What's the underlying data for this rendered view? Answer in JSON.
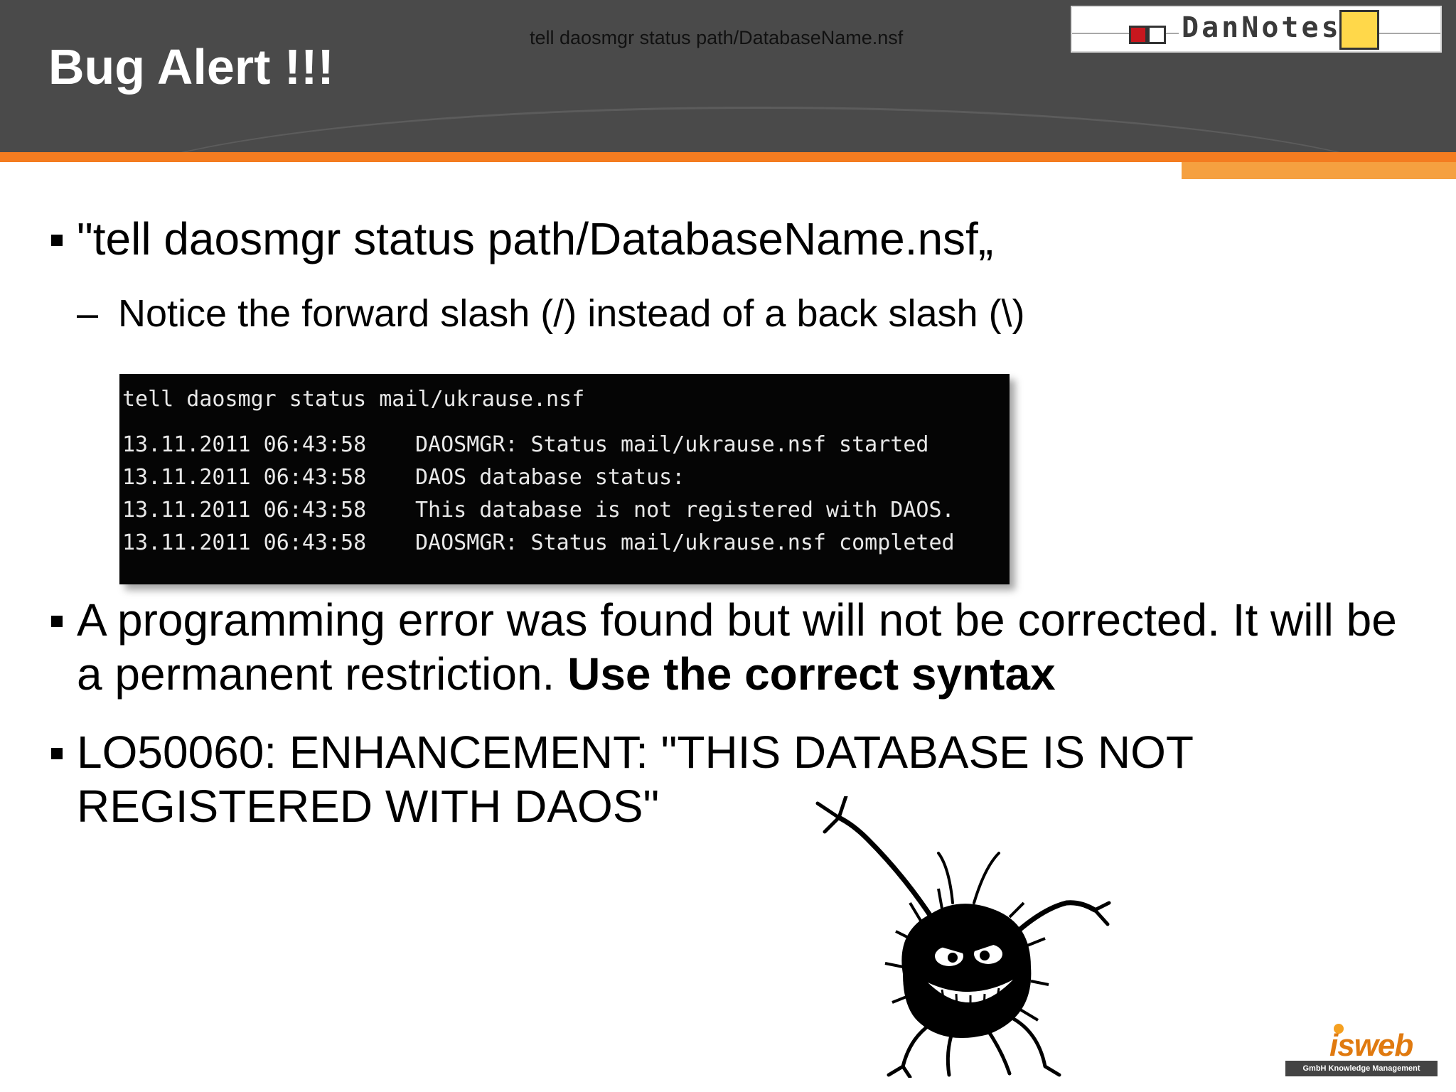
{
  "header": {
    "title": "Bug Alert !!!",
    "caption": "tell daosmgr status path/DatabaseName.nsf"
  },
  "logo_dannotes": {
    "text": "DanNotes"
  },
  "bullets": {
    "b1": "\"tell daosmgr status path/DatabaseName.nsf„",
    "sub1_dash": "–",
    "sub1": "Notice the forward slash (/) instead of a back slash (\\)",
    "b2_plain": "A programming error was found but will not be corrected. It will be a permanent restriction. ",
    "b2_bold": "Use the correct syntax",
    "b3": "LO50060: ENHANCEMENT: \"THIS DATABASE IS NOT REGISTERED WITH DAOS\""
  },
  "console": {
    "command": "tell daosmgr status mail/ukrause.nsf",
    "rows": [
      {
        "timestamp": "13.11.2011 06:43:58",
        "message": "DAOSMGR: Status mail/ukrause.nsf started"
      },
      {
        "timestamp": "13.11.2011 06:43:58",
        "message": "DAOS database status:"
      },
      {
        "timestamp": "13.11.2011 06:43:58",
        "message": "This database is not registered with DAOS."
      },
      {
        "timestamp": "13.11.2011 06:43:58",
        "message": "DAOSMGR: Status mail/ukrause.nsf completed"
      }
    ]
  },
  "logo_isweb": {
    "name": "isweb",
    "tagline": "GmbH Knowledge Management"
  },
  "colors": {
    "header_bg": "#4a4a4a",
    "accent_orange": "#f47c20"
  }
}
